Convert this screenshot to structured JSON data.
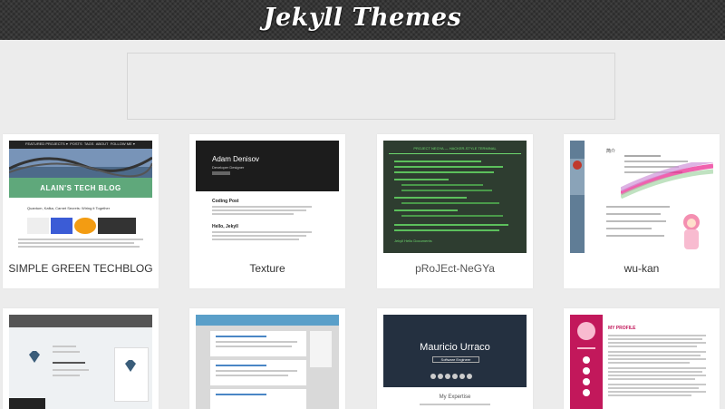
{
  "site": {
    "title": "Jekyll Themes"
  },
  "themes": [
    {
      "name": "SIMPLE GREEN TECHBLOG",
      "preview": {
        "nav": [
          "FEATURED PROJECTS ▾",
          "POSTS",
          "TAGS",
          "ABOUT",
          "FOLLOW ME ▾"
        ],
        "banner": "ALAIN'S TECH BLOG",
        "post_title": "Quantum, Kafka, Carnet Secrets: Wiring it Together",
        "brand_color": "#5fa87b"
      }
    },
    {
      "name": "Texture",
      "preview": {
        "author": "Adam Denisov",
        "role": "Developer Designer",
        "posts": [
          "Coding Post",
          "Hello, Jekyll"
        ]
      }
    },
    {
      "name": "pRoJEct-NeGYa",
      "preview": {
        "heading": "PROJECT NEGYA — HACKER-STYLE TERMINAL",
        "footer": "Jekyll Hello Documents"
      }
    },
    {
      "name": "wu-kan",
      "preview": {
        "heading": "简介"
      }
    },
    {
      "name": "",
      "preview": {}
    },
    {
      "name": "",
      "preview": {}
    },
    {
      "name": "",
      "preview": {
        "author": "Mauricio Urraco",
        "role": "Software Engineer",
        "section": "My Expertise"
      }
    },
    {
      "name": "",
      "preview": {
        "section": "MY PROFILE"
      }
    }
  ]
}
